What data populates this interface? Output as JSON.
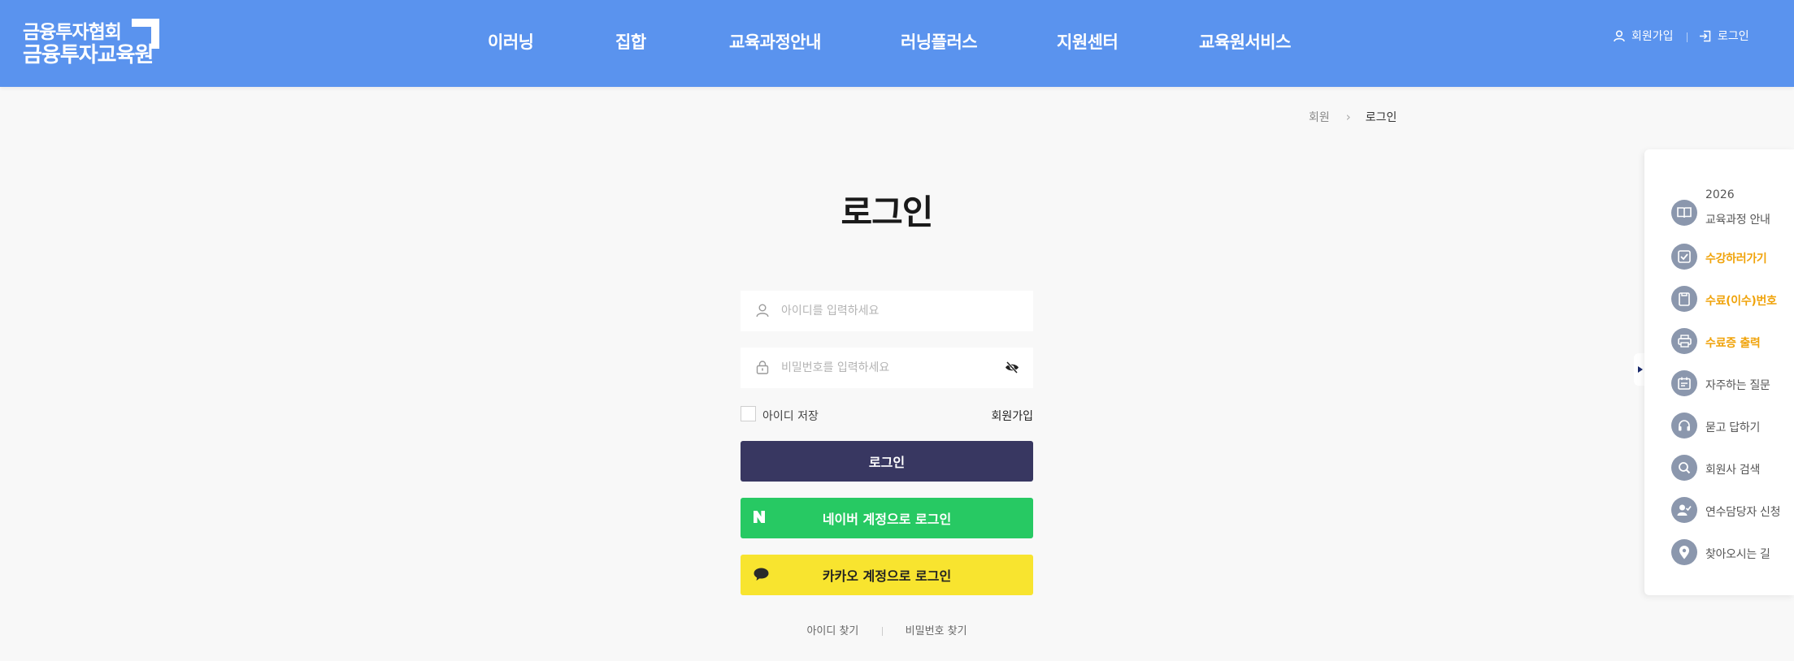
{
  "header": {
    "logo": {
      "line1": "금융투자협회",
      "line2": "금융투자교육원"
    },
    "nav": [
      "이러닝",
      "집합",
      "교육과정안내",
      "러닝플러스",
      "지원센터",
      "교육원서비스"
    ],
    "utils": {
      "signup": "회원가입",
      "login": "로그인"
    }
  },
  "breadcrumb": {
    "parent": "회원",
    "separator": "›",
    "current": "로그인"
  },
  "login": {
    "title": "로그인",
    "id_placeholder": "아이디를 입력하세요",
    "pw_placeholder": "비밀번호를 입력하세요",
    "save_id": "아이디 저장",
    "signup": "회원가입",
    "login_button": "로그인",
    "naver_button": "네이버 계정으로 로그인",
    "kakao_button": "카카오 계정으로 로그인",
    "find_id": "아이디 찾기",
    "find_pw": "비밀번호 찾기"
  },
  "quick_menu": {
    "items": [
      {
        "year": "2026",
        "label": "교육과정 안내",
        "icon": "book-icon",
        "accent": false
      },
      {
        "label": "수강하러가기",
        "icon": "check-square-icon",
        "accent": true
      },
      {
        "label": "수료(이수)번호",
        "icon": "document-icon",
        "accent": true
      },
      {
        "label": "수료증 출력",
        "icon": "printer-icon",
        "accent": true
      },
      {
        "label": "자주하는 질문",
        "icon": "calendar-icon",
        "accent": false
      },
      {
        "label": "묻고 답하기",
        "icon": "headset-icon",
        "accent": false
      },
      {
        "label": "회원사 검색",
        "icon": "search-icon",
        "accent": false
      },
      {
        "label": "연수담당자 신청",
        "icon": "user-check-icon",
        "accent": false
      },
      {
        "label": "찾아오시는 길",
        "icon": "map-pin-icon",
        "accent": false
      }
    ]
  },
  "colors": {
    "header": "#5a93ee",
    "login_button": "#383761",
    "naver": "#27c963",
    "kakao": "#f8e42f",
    "accent": "#f0a30a",
    "quick_icon": "#8b97ad"
  }
}
